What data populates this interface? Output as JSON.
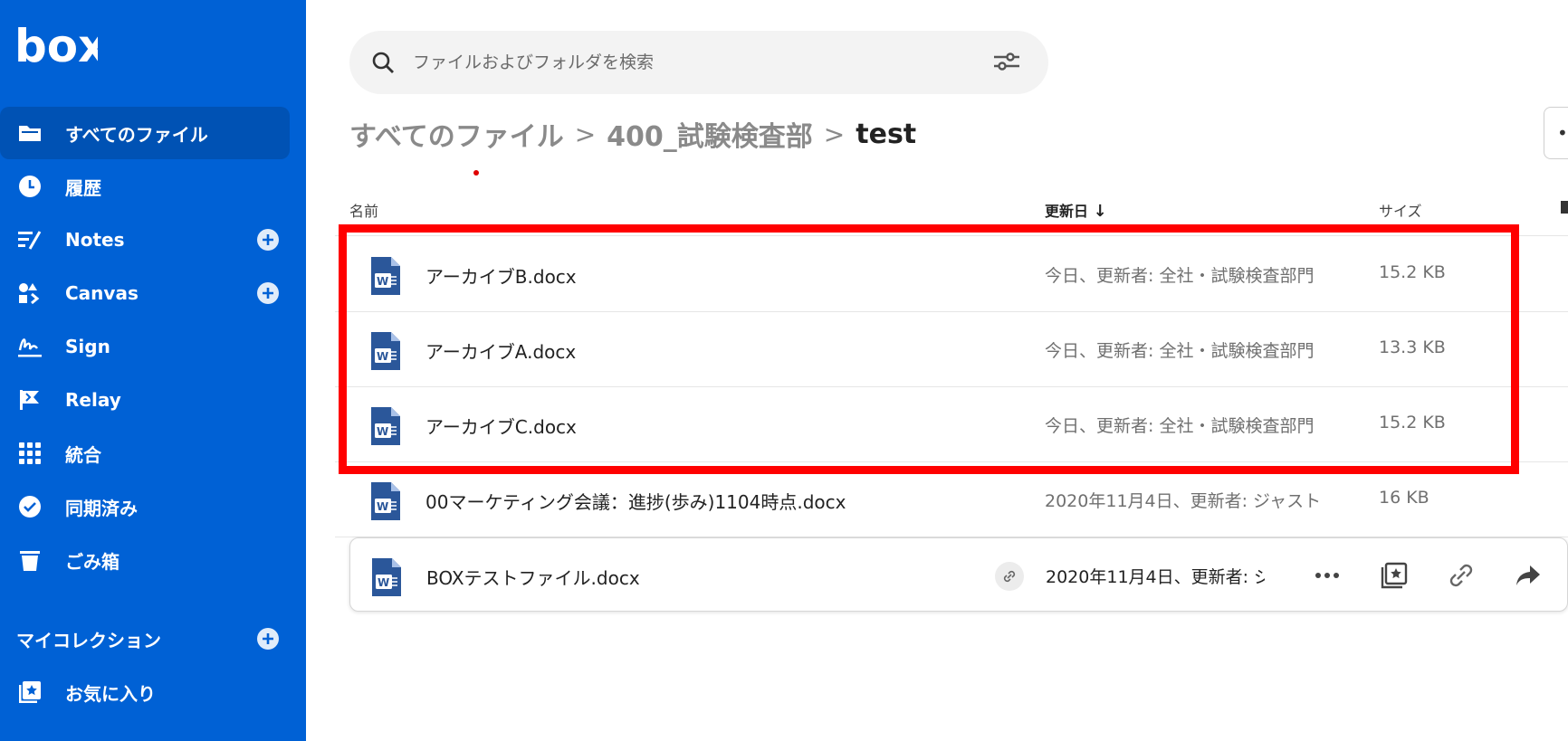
{
  "sidebar": {
    "logo_text": "box",
    "items": [
      {
        "label": "すべてのファイル",
        "icon": "folder-icon"
      },
      {
        "label": "履歴",
        "icon": "clock-icon"
      },
      {
        "label": "Notes",
        "icon": "notes-icon"
      },
      {
        "label": "Canvas",
        "icon": "canvas-icon"
      },
      {
        "label": "Sign",
        "icon": "sign-icon"
      },
      {
        "label": "Relay",
        "icon": "relay-icon"
      },
      {
        "label": "統合",
        "icon": "grid-icon"
      },
      {
        "label": "同期済み",
        "icon": "check-circle-icon"
      },
      {
        "label": "ごみ箱",
        "icon": "trash-icon"
      }
    ],
    "collections_title": "マイコレクション",
    "favorites_label": "お気に入り"
  },
  "search": {
    "placeholder": "ファイルおよびフォルダを検索"
  },
  "breadcrumb": {
    "root": "すべてのファイル",
    "parent": "400_試験検査部",
    "current": "test"
  },
  "table": {
    "headers": {
      "name": "名前",
      "modified": "更新日",
      "size": "サイズ"
    },
    "sort_arrow": "↓",
    "rows": [
      {
        "name": "アーカイブB.docx",
        "modified": "今日、更新者: 全社・試験検査部門",
        "size": "15.2 KB"
      },
      {
        "name": "アーカイブA.docx",
        "modified": "今日、更新者: 全社・試験検査部門",
        "size": "13.3 KB"
      },
      {
        "name": "アーカイブC.docx",
        "modified": "今日、更新者: 全社・試験検査部門",
        "size": "15.2 KB"
      },
      {
        "name": "00マーケティング会議：進捗(歩み)1104時点.docx",
        "modified": "2020年11月4日、更新者: ジャスト",
        "size": "16 KB"
      },
      {
        "name": "BOXテストファイル.docx",
        "modified": "2020年11月4日、更新者: ジ",
        "size": ""
      }
    ]
  },
  "colors": {
    "brand": "#0061d5",
    "highlight": "#ff0000",
    "word_icon": "#2b579a"
  }
}
